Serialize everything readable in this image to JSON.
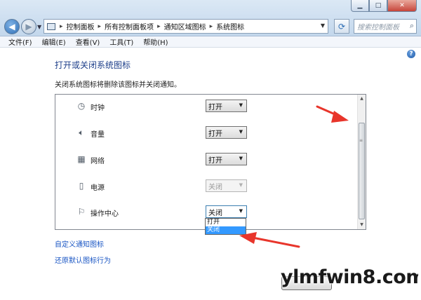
{
  "address_bar": {
    "crumbs": [
      "控制面板",
      "所有控制面板项",
      "通知区域图标",
      "系统图标"
    ]
  },
  "search": {
    "placeholder": "搜索控制面板"
  },
  "menu": [
    "文件(F)",
    "编辑(E)",
    "查看(V)",
    "工具(T)",
    "帮助(H)"
  ],
  "content": {
    "heading": "打开或关闭系统图标",
    "description": "关闭系统图标将删除该图标并关闭通知。"
  },
  "icons": [
    {
      "label": "时钟",
      "icon": "clock-icon",
      "value": "打开",
      "disabled": false
    },
    {
      "label": "音量",
      "icon": "speaker-icon",
      "value": "打开",
      "disabled": false
    },
    {
      "label": "网络",
      "icon": "network-icon",
      "value": "打开",
      "disabled": false
    },
    {
      "label": "电源",
      "icon": "power-icon",
      "value": "关闭",
      "disabled": true
    },
    {
      "label": "操作中心",
      "icon": "flag-icon",
      "value": "关闭",
      "disabled": false
    }
  ],
  "dropdown": {
    "options": [
      "打开",
      "关闭"
    ],
    "selected_index": 1
  },
  "links": {
    "customize": "自定义通知图标",
    "restore": "还原默认图标行为"
  },
  "watermark": "ylmfwin8.com",
  "colors": {
    "link": "#1a56c4",
    "heading": "#1e3f8a",
    "selection": "#3399ff",
    "arrow": "#e8352b"
  }
}
